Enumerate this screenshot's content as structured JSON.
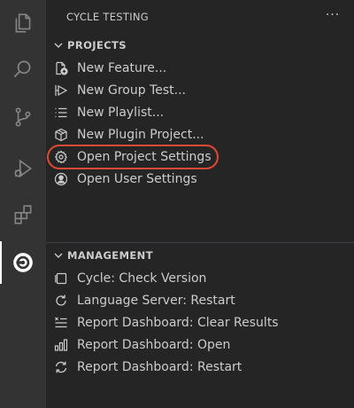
{
  "sidebar": {
    "title": "CYCLE TESTING",
    "more_label": "···",
    "projects": {
      "title": "PROJECTS",
      "items": [
        {
          "label": "New Feature...",
          "icon": "new-feature-icon"
        },
        {
          "label": "New Group Test...",
          "icon": "group-test-icon"
        },
        {
          "label": "New Playlist...",
          "icon": "list-icon"
        },
        {
          "label": "New Plugin Project...",
          "icon": "package-icon"
        },
        {
          "label": "Open Project Settings",
          "icon": "gear-icon",
          "highlighted": true
        },
        {
          "label": "Open User Settings",
          "icon": "account-icon"
        }
      ]
    },
    "management": {
      "title": "MANAGEMENT",
      "items": [
        {
          "label": "Cycle: Check Version",
          "icon": "versions-icon"
        },
        {
          "label": "Language Server: Restart",
          "icon": "refresh-icon"
        },
        {
          "label": "Report Dashboard: Clear Results",
          "icon": "clear-all-icon"
        },
        {
          "label": "Report Dashboard: Open",
          "icon": "graph-icon"
        },
        {
          "label": "Report Dashboard: Restart",
          "icon": "sync-icon"
        }
      ]
    }
  },
  "activity_bar": [
    {
      "name": "explorer-icon"
    },
    {
      "name": "search-icon"
    },
    {
      "name": "source-control-icon"
    },
    {
      "name": "run-debug-icon"
    },
    {
      "name": "extensions-icon"
    },
    {
      "name": "cycle-testing-icon",
      "active": true
    }
  ],
  "colors": {
    "highlight_ring": "#e04a35",
    "activity_bg": "#333333",
    "sidebar_bg": "#252526"
  }
}
